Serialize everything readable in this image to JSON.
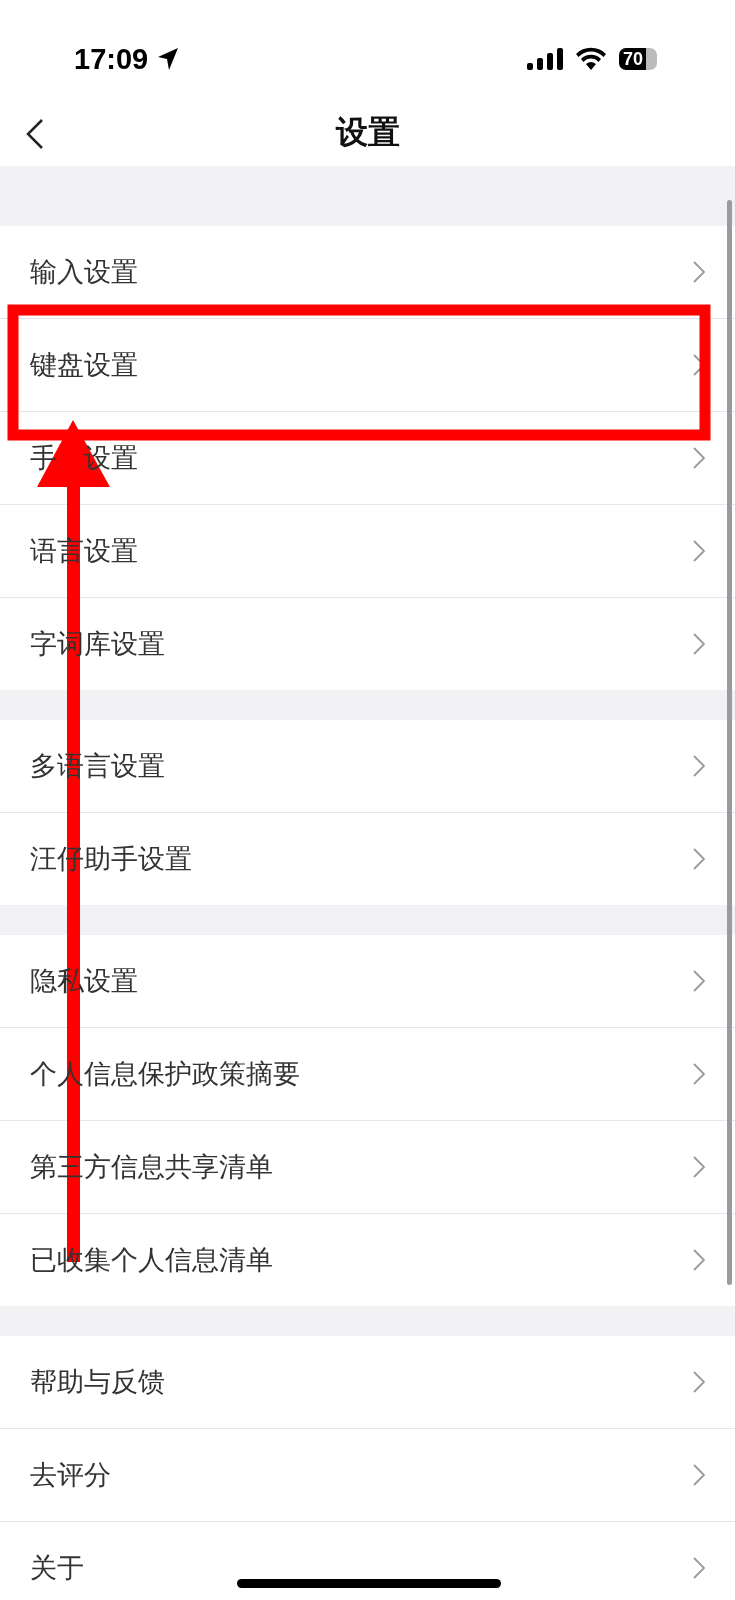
{
  "status_bar": {
    "time": "17:09",
    "battery": "70"
  },
  "nav": {
    "title": "设置"
  },
  "groups": [
    {
      "items": [
        {
          "label": "输入设置"
        },
        {
          "label": "键盘设置"
        },
        {
          "label": "手",
          "label_after_gap": "设置"
        },
        {
          "label": "语言设置"
        },
        {
          "label": "字词库设置"
        }
      ]
    },
    {
      "items": [
        {
          "label": "多语言设置"
        },
        {
          "label": "汪仔助手设置"
        }
      ]
    },
    {
      "items": [
        {
          "label": "隐私设置"
        },
        {
          "label": "个人信息保护政策摘要"
        },
        {
          "label": "第三方信息共享清单"
        },
        {
          "label": "已收集个人信息清单"
        }
      ]
    },
    {
      "items": [
        {
          "label": "帮助与反馈"
        },
        {
          "label": "去评分"
        },
        {
          "label": "关于"
        }
      ]
    }
  ]
}
